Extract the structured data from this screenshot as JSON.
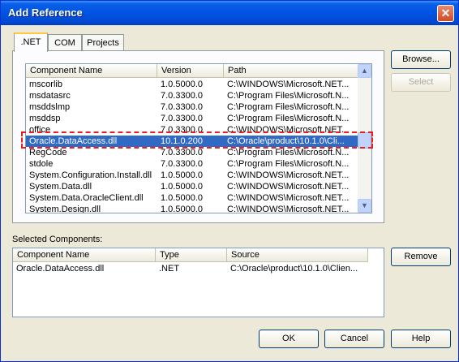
{
  "window": {
    "title": "Add Reference",
    "close_glyph": "✕"
  },
  "tabs": [
    {
      "label": ".NET",
      "active": true
    },
    {
      "label": "COM",
      "active": false
    },
    {
      "label": "Projects",
      "active": false
    }
  ],
  "components_list": {
    "headers": [
      "Component Name",
      "Version",
      "Path"
    ],
    "rows": [
      {
        "name": "mscorlib",
        "version": "1.0.5000.0",
        "path": "C:\\WINDOWS\\Microsoft.NET..."
      },
      {
        "name": "msdatasrc",
        "version": "7.0.3300.0",
        "path": "C:\\Program Files\\Microsoft.N..."
      },
      {
        "name": "msddslmp",
        "version": "7.0.3300.0",
        "path": "C:\\Program Files\\Microsoft.N..."
      },
      {
        "name": "msddsp",
        "version": "7.0.3300.0",
        "path": "C:\\Program Files\\Microsoft.N..."
      },
      {
        "name": "office",
        "version": "7.0.3300.0",
        "path": "C:\\WINDOWS\\Microsoft.NET..."
      },
      {
        "name": "Oracle.DataAccess.dll",
        "version": "10.1.0.200",
        "path": "C:\\Oracle\\product\\10.1.0\\Cli...",
        "selected": true
      },
      {
        "name": "RegCode",
        "version": "7.0.3300.0",
        "path": "C:\\Program Files\\Microsoft.N..."
      },
      {
        "name": "stdole",
        "version": "7.0.3300.0",
        "path": "C:\\Program Files\\Microsoft.N..."
      },
      {
        "name": "System.Configuration.Install.dll",
        "version": "1.0.5000.0",
        "path": "C:\\WINDOWS\\Microsoft.NET..."
      },
      {
        "name": "System.Data.dll",
        "version": "1.0.5000.0",
        "path": "C:\\WINDOWS\\Microsoft.NET..."
      },
      {
        "name": "System.Data.OracleClient.dll",
        "version": "1.0.5000.0",
        "path": "C:\\WINDOWS\\Microsoft.NET..."
      },
      {
        "name": "System.Design.dll",
        "version": "1.0.5000.0",
        "path": "C:\\WINDOWS\\Microsoft.NET..."
      }
    ]
  },
  "buttons": {
    "browse": "Browse...",
    "select": "Select",
    "remove": "Remove",
    "ok": "OK",
    "cancel": "Cancel",
    "help": "Help"
  },
  "selected_components": {
    "label": "Selected Components:",
    "headers": [
      "Component Name",
      "Type",
      "Source"
    ],
    "rows": [
      {
        "name": "Oracle.DataAccess.dll",
        "type": ".NET",
        "source": "C:\\Oracle\\product\\10.1.0\\Clien..."
      }
    ]
  },
  "colors": {
    "selection": "#316ac5",
    "title_bar": "#0054e3",
    "highlight_annotation": "#e81e1e"
  }
}
